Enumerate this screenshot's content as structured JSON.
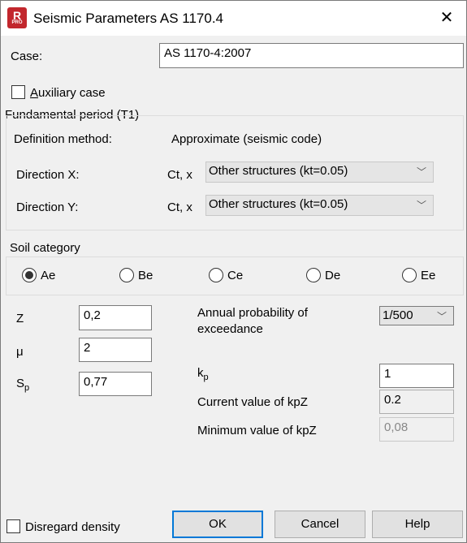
{
  "window": {
    "title": "Seismic Parameters AS 1170.4",
    "icon_text": "R",
    "icon_subtext": "PRO"
  },
  "case": {
    "label": "Case:",
    "value": "AS 1170-4:2007"
  },
  "auxiliary": {
    "label": "Auxiliary case",
    "checked": false
  },
  "fundamental": {
    "group_label": "Fundamental period (T1)",
    "definition_label": "Definition method:",
    "definition_value": "Approximate (seismic code)",
    "dir_x_label": "Direction X:",
    "dir_y_label": "Direction Y:",
    "ct_label_x": "Ct, x",
    "ct_label_y": "Ct, x",
    "dir_x_value": "Other structures (kt=0.05)",
    "dir_y_value": "Other structures (kt=0.05)"
  },
  "soil": {
    "group_label": "Soil category",
    "options": [
      "Ae",
      "Be",
      "Ce",
      "De",
      "Ee"
    ],
    "selected": "Ae"
  },
  "params": {
    "z_label": "Z",
    "z_value": "0,2",
    "mu_label": "μ",
    "mu_value": "2",
    "sp_label_main": "S",
    "sp_label_sub": "p",
    "sp_value": "0,77"
  },
  "probability": {
    "label_line1": "Annual probability of",
    "label_line2": "exceedance",
    "value": "1/500"
  },
  "kp": {
    "label_main": "k",
    "label_sub": "p",
    "value": "1",
    "current_label": "Current value of kpZ",
    "current_value": "0.2",
    "min_label": "Minimum value of kpZ",
    "min_value": "0,08"
  },
  "footer": {
    "disregard_label": "Disregard density",
    "ok": "OK",
    "cancel": "Cancel",
    "help": "Help"
  }
}
